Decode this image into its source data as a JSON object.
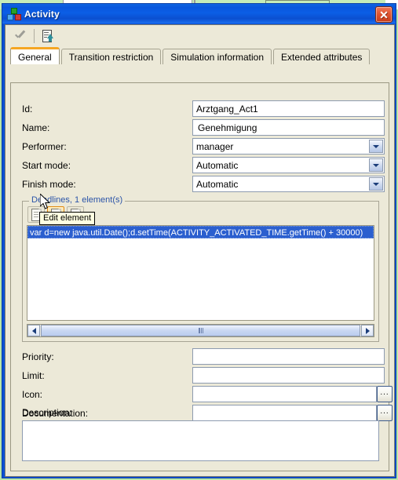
{
  "window": {
    "title": "Activity",
    "icon": "activity-node-icon",
    "close_label": "✕"
  },
  "toolbar": {
    "apply_icon": "checkmark-icon",
    "export_icon": "document-export-icon"
  },
  "tabs": [
    {
      "label": "General",
      "active": true
    },
    {
      "label": "Transition restriction",
      "active": false
    },
    {
      "label": "Simulation information",
      "active": false
    },
    {
      "label": "Extended attributes",
      "active": false
    }
  ],
  "form": {
    "id": {
      "label": "Id:",
      "value": "Arztgang_Act1"
    },
    "name": {
      "label": "Name:",
      "value": "Genehmigung"
    },
    "performer": {
      "label": "Performer:",
      "value": "manager"
    },
    "start_mode": {
      "label": "Start mode:",
      "value": "Automatic"
    },
    "finish_mode": {
      "label": "Finish mode:",
      "value": "Automatic"
    },
    "priority": {
      "label": "Priority:",
      "value": ""
    },
    "limit": {
      "label": "Limit:",
      "value": ""
    },
    "icon": {
      "label": "Icon:",
      "value": "",
      "browse": "..."
    },
    "documentation": {
      "label": "Documentation:",
      "value": "",
      "browse": "..."
    },
    "description": {
      "label": "Description:",
      "value": ""
    }
  },
  "deadlines": {
    "group_title": "Deadlines, 1 element(s)",
    "buttons": [
      {
        "name": "new-element-button",
        "icon": "new-document-icon"
      },
      {
        "name": "edit-element-button",
        "icon": "edit-document-icon",
        "hover": true
      },
      {
        "name": "delete-element-button",
        "icon": "delete-document-icon"
      }
    ],
    "items": [
      "var d=new java.util.Date();d.setTime(ACTIVITY_ACTIVATED_TIME.getTime() + 30000)"
    ],
    "scroll_left": "◀",
    "scroll_right": "▶"
  },
  "tooltip": {
    "text": "Edit element"
  },
  "colors": {
    "titlebar": "#0b5ee6",
    "dialog_face": "#ece9d8",
    "selection": "#2b5fcf",
    "active_tab_accent": "#f5a623",
    "group_title": "#2b54a8",
    "tooltip_bg": "#ffffe1",
    "desktop": "#c6ecb8"
  }
}
